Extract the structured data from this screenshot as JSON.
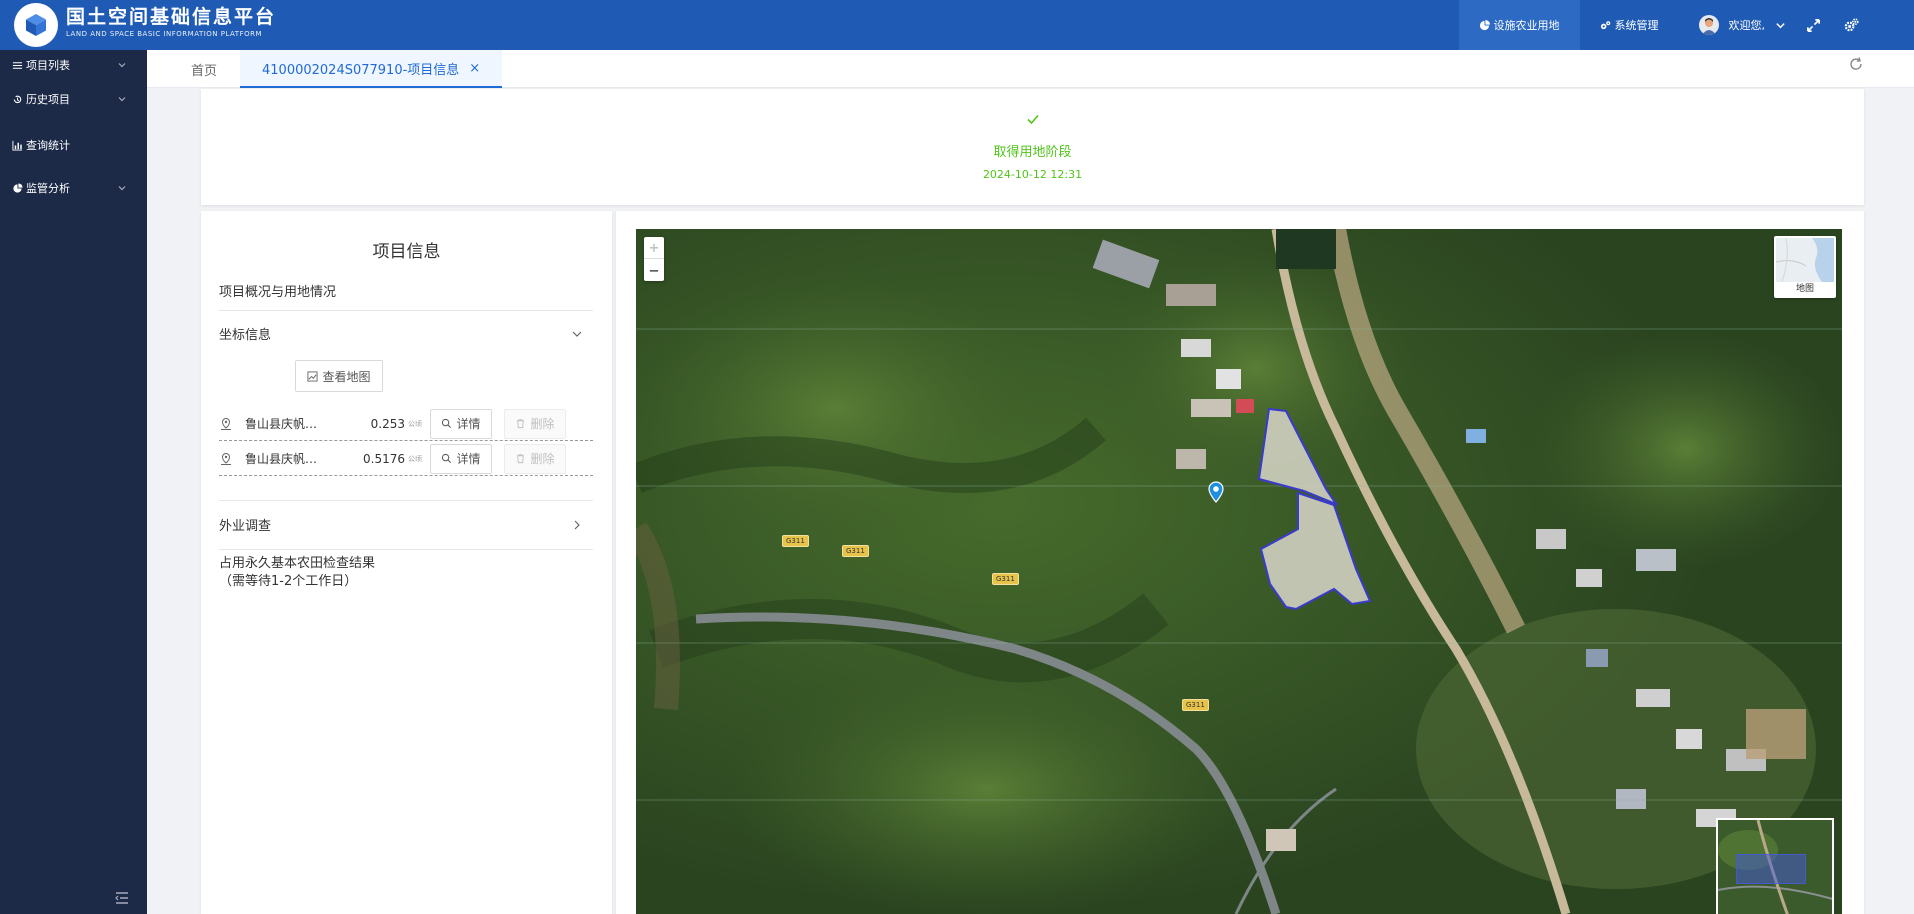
{
  "header": {
    "title": "国土空间基础信息平台",
    "subtitle": "LAND AND SPACE BASIC INFORMATION PLATFORM",
    "nav": [
      {
        "label": "设施农业用地",
        "active": true
      },
      {
        "label": "系统管理",
        "active": false
      }
    ],
    "user_greeting": "欢迎您,"
  },
  "sidebar": {
    "items": [
      {
        "label": "项目列表",
        "icon": "list-icon",
        "expandable": true
      },
      {
        "label": "历史项目",
        "icon": "history-icon",
        "expandable": true
      },
      {
        "label": "查询统计",
        "icon": "bar-chart-icon",
        "expandable": false
      },
      {
        "label": "监管分析",
        "icon": "pie-chart-icon",
        "expandable": true
      }
    ]
  },
  "tabs": {
    "home": "首页",
    "active": "4100002024S077910-项目信息",
    "close": "×"
  },
  "status": {
    "title": "取得用地阶段",
    "time": "2024-10-12 12:31",
    "color": "#52c41a"
  },
  "project": {
    "title": "项目信息",
    "overview_label": "项目概况与用地情况",
    "coord_section_label": "坐标信息",
    "view_map_label": "查看地图",
    "coords": [
      {
        "name": "鲁山县庆帆…",
        "value": "0.253",
        "unit": "公顷",
        "detail": "详情",
        "delete": "删除"
      },
      {
        "name": "鲁山县庆帆…",
        "value": "0.5176",
        "unit": "公顷",
        "detail": "详情",
        "delete": "删除"
      }
    ],
    "field_survey_label": "外业调查",
    "check_result_line1": "占用永久基本农田检查结果",
    "check_result_line2": "（需等待1-2个工作日）"
  },
  "map": {
    "zoom_in": "+",
    "zoom_out": "−",
    "basemap_label": "地图",
    "road_labels": [
      "G311",
      "G311",
      "G311",
      "G311"
    ],
    "accent": "#1f5bb4"
  }
}
